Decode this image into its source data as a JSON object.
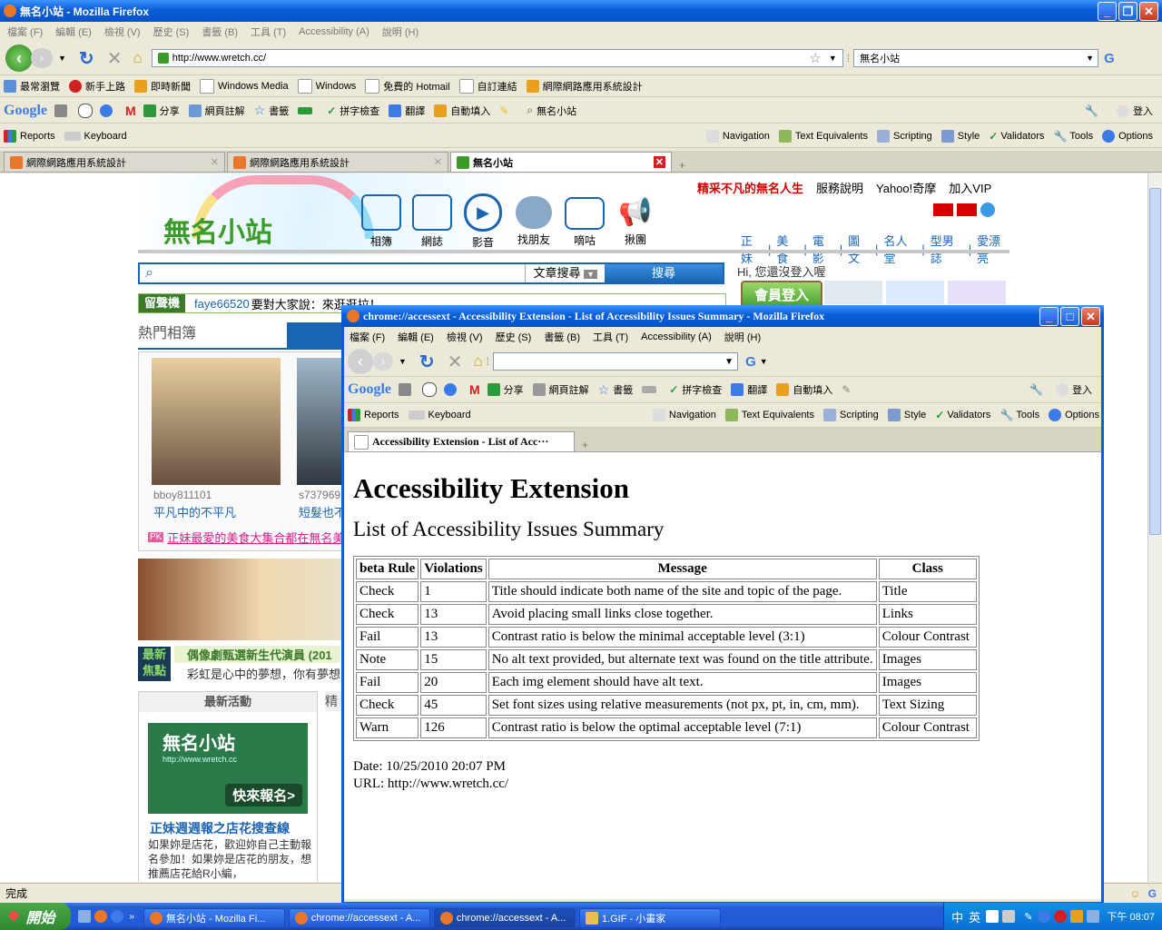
{
  "main_window": {
    "title": "無名小站 - Mozilla Firefox",
    "menu": [
      "檔案 (F)",
      "編輯 (E)",
      "檢視 (V)",
      "歷史 (S)",
      "書籤 (B)",
      "工具 (T)",
      "Accessibility (A)",
      "說明 (H)"
    ],
    "url": "http://www.wretch.cc/",
    "search_value": "無名小站",
    "bookmarks": [
      "最常瀏覽",
      "新手上路",
      "即時新聞",
      "Windows Media",
      "Windows",
      "免費的 Hotmail",
      "自訂連結",
      "網際網路應用系統設計"
    ],
    "google_toolbar": [
      "分享",
      "網頁註解",
      "書籤",
      "拼字檢查",
      "翻譯",
      "自動填入",
      "無名小站",
      "登入"
    ],
    "acc_toolbar": {
      "reports": "Reports",
      "keyboard": "Keyboard",
      "navigation": "Navigation",
      "text_equivalents": "Text Equivalents",
      "scripting": "Scripting",
      "style": "Style",
      "validators": "Validators",
      "tools": "Tools",
      "options": "Options"
    },
    "tabs": [
      "網際網路應用系統設計",
      "網際網路應用系統設計",
      "無名小站"
    ],
    "status": "完成"
  },
  "site": {
    "logo": "無名小站",
    "nav_icons": [
      "相簿",
      "網誌",
      "影音",
      "找朋友",
      "嘀咕",
      "揪團"
    ],
    "top_links": [
      "精采不凡的無名人生",
      "服務說明",
      "Yahoo!奇摩",
      "加入VIP"
    ],
    "categories": [
      "正妹",
      "美食",
      "電影",
      "圖文",
      "名人堂",
      "型男誌",
      "愛漂亮"
    ],
    "search_option": "文章搜尋",
    "search_button": "搜尋",
    "greeting": "Hi, 您還沒登入喔",
    "login": "會員登入",
    "message_label": "留聲機",
    "message_user": "faye66520",
    "message_text": "要對大家說：來逛逛拉！",
    "hot_album": "熱門相簿",
    "album1_user": "bboy811101",
    "album1_caption": "平凡中的不平凡",
    "album2_user": "s737969",
    "album2_caption": "短髮也不",
    "pk_text": "正妹最愛的美食大集合都在無名美",
    "latest_label1": "最新",
    "latest_label2": "焦點",
    "latest_title": "偶像劇甄選新生代演員",
    "latest_year": "(201",
    "latest_desc": "彩虹是心中的夢想，你有夢想",
    "activity_title": "最新活動",
    "activity_side": "精",
    "promo_logo": "無名小站",
    "promo_url": "http://www.wretch.cc",
    "promo_button": "快來報名>",
    "promo_title": "正妹週週報之店花搜查線",
    "promo_desc": "如果妳是店花，歡迎妳自己主動報名參加！如果妳是店花的朋友，想推薦店花給R小編，"
  },
  "popup": {
    "title": "chrome://accessext - Accessibility Extension - List of Accessibility Issues Summary - Mozilla Firefox",
    "menu": [
      "檔案 (F)",
      "編輯 (E)",
      "檢視 (V)",
      "歷史 (S)",
      "書籤 (B)",
      "工具 (T)",
      "Accessibility (A)",
      "說明 (H)"
    ],
    "google_toolbar": [
      "分享",
      "網頁註解",
      "書籤",
      "拼字檢查",
      "翻譯",
      "自動填入",
      "登入"
    ],
    "tab": "Accessibility Extension - List of Acc···",
    "h1": "Accessibility Extension",
    "h2": "List of Accessibility Issues Summary",
    "table": {
      "headers": [
        "beta Rule",
        "Violations",
        "Message",
        "Class"
      ],
      "rows": [
        [
          "Check",
          "1",
          "Title should indicate both name of the site and topic of the page.",
          "Title"
        ],
        [
          "Check",
          "13",
          "Avoid placing small links close together.",
          "Links"
        ],
        [
          "Fail",
          "13",
          "Contrast ratio is below the minimal acceptable level (3:1)",
          "Colour Contrast"
        ],
        [
          "Note",
          "15",
          "No alt text provided, but alternate text was found on the title attribute.",
          "Images"
        ],
        [
          "Fail",
          "20",
          "Each img element should have alt text.",
          "Images"
        ],
        [
          "Check",
          "45",
          "Set font sizes using relative measurements (not px, pt, in, cm, mm).",
          "Text Sizing"
        ],
        [
          "Warn",
          "126",
          "Contrast ratio is below the optimal acceptable level (7:1)",
          "Colour Contrast"
        ]
      ]
    },
    "date": "Date: 10/25/2010 20:07 PM",
    "url_line": "URL: http://www.wretch.cc/"
  },
  "taskbar": {
    "start": "開始",
    "tasks": [
      "無名小站 - Mozilla Fi...",
      "chrome://accessext - A...",
      "chrome://accessext - A...",
      "1.GIF - 小畫家"
    ],
    "clock": "下午 08:07"
  },
  "colors": {
    "xp_blue": "#0a5fd8",
    "site_green": "#3a9a2a",
    "site_link": "#1a64b4",
    "red_text": "#d40000"
  }
}
